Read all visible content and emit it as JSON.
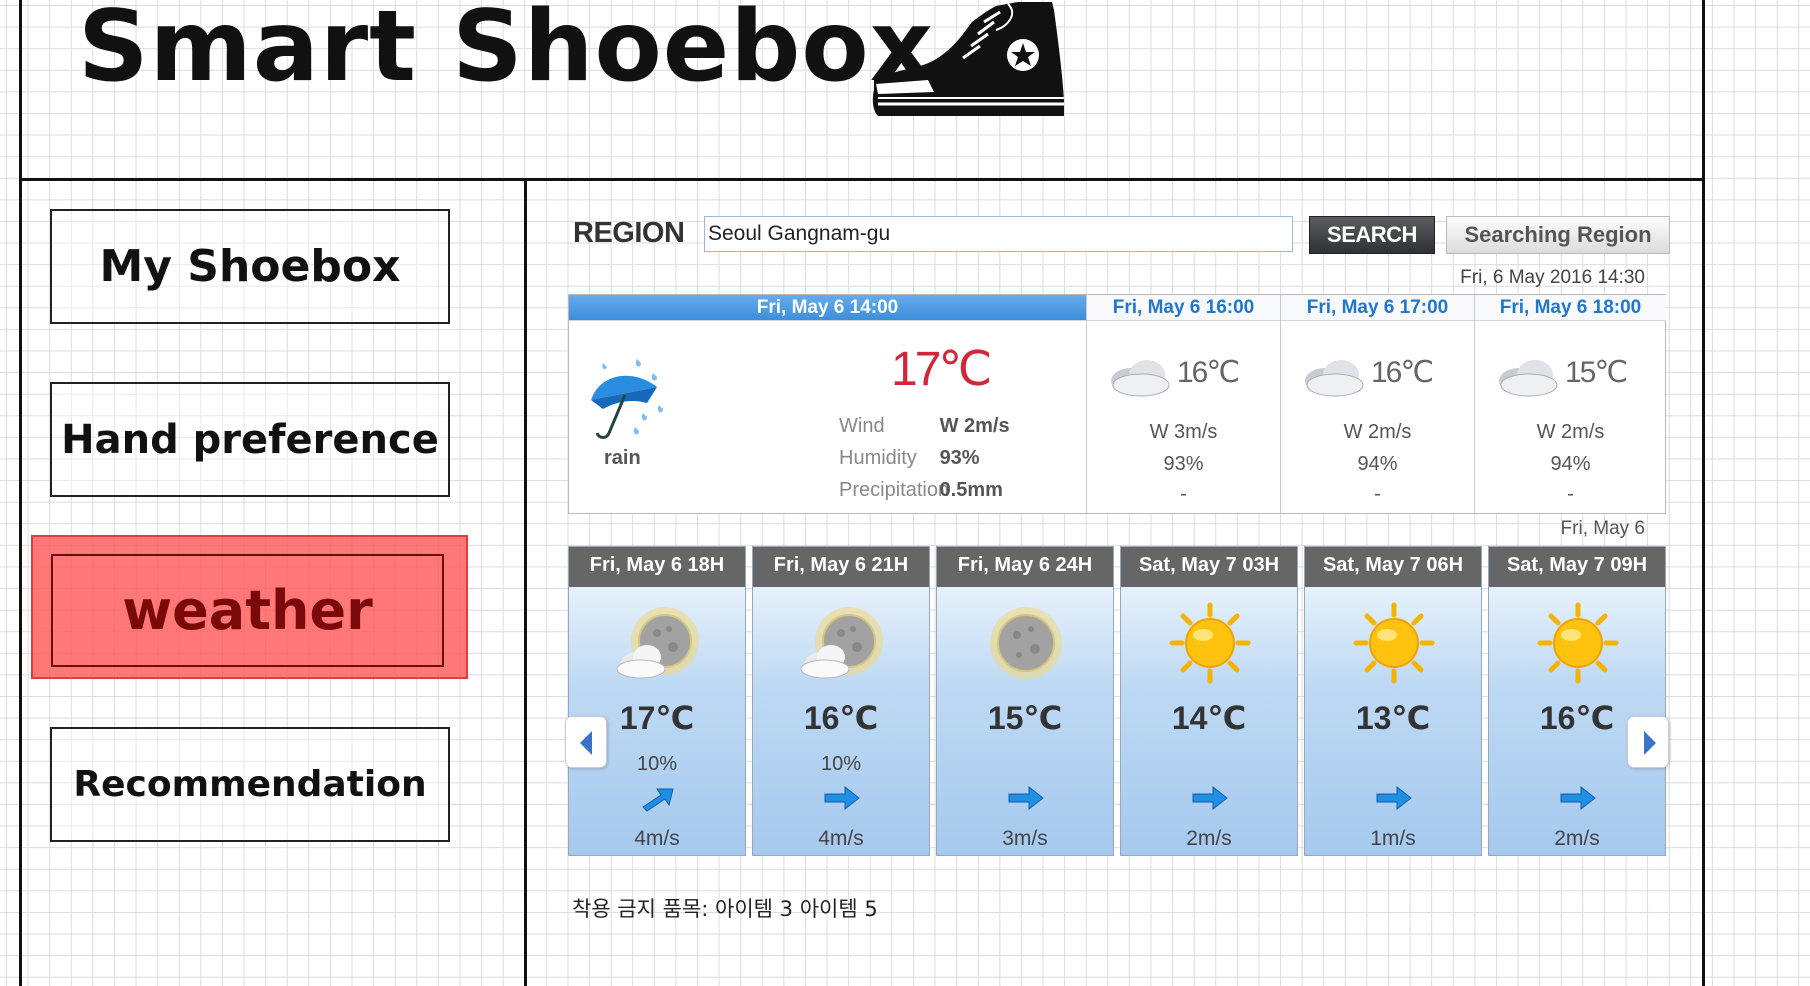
{
  "app": {
    "title": "Smart Shoebox"
  },
  "icons": {
    "logo": "sneaker-icon",
    "rain": "rain-umbrella-icon",
    "cloudy": "cloud-icon",
    "moon_cloud": "moon-cloud-icon",
    "moon": "moon-icon",
    "sun": "sun-icon",
    "wind": "wind-arrow-icon",
    "prev": "chevron-left-icon",
    "next": "chevron-right-icon"
  },
  "colors": {
    "active_nav": "#ff5a5a",
    "active_text": "#7a0909",
    "current_temp": "#d0283a",
    "header_blue": "#3d8edb",
    "card_head": "#666666"
  },
  "sidebar": {
    "items": [
      {
        "label": "My Shoebox",
        "active": false
      },
      {
        "label": "Hand preference",
        "active": false
      },
      {
        "label": "weather",
        "active": true
      },
      {
        "label": "Recommendation",
        "active": false
      }
    ]
  },
  "region": {
    "label": "REGION",
    "value": "Seoul Gangnam-gu",
    "search_label": "SEARCH",
    "searching_label": "Searching Region",
    "updated": "Fri, 6 May 2016 14:30"
  },
  "current": {
    "header": "Fri, May 6  14:00",
    "temp": "17℃",
    "condition": "rain",
    "details": [
      {
        "key": "Wind",
        "value": "W 2m/s"
      },
      {
        "key": "Humidity",
        "value": "93%"
      },
      {
        "key": "Precipitation",
        "value": "0.5mm"
      }
    ]
  },
  "hourly": [
    {
      "header": "Fri, May 6  16:00",
      "temp": "16℃",
      "wind": "W 3m/s",
      "humidity": "93%",
      "precip": "-"
    },
    {
      "header": "Fri, May 6  17:00",
      "temp": "16℃",
      "wind": "W 2m/s",
      "humidity": "94%",
      "precip": "-"
    },
    {
      "header": "Fri, May 6  18:00",
      "temp": "15℃",
      "wind": "W 2m/s",
      "humidity": "94%",
      "precip": "-"
    }
  ],
  "forecast_date": "Fri, May 6",
  "forecast": [
    {
      "header": "Fri, May 6 18H",
      "icon": "moon-cloud",
      "temp": "17℃",
      "prob": "10%",
      "wind": "4m/s"
    },
    {
      "header": "Fri, May 6 21H",
      "icon": "moon-cloud",
      "temp": "16℃",
      "prob": "10%",
      "wind": "4m/s"
    },
    {
      "header": "Fri, May 6 24H",
      "icon": "moon",
      "temp": "15℃",
      "prob": "",
      "wind": "3m/s"
    },
    {
      "header": "Sat, May 7 03H",
      "icon": "sun",
      "temp": "14℃",
      "prob": "",
      "wind": "2m/s"
    },
    {
      "header": "Sat, May 7 06H",
      "icon": "sun",
      "temp": "13℃",
      "prob": "",
      "wind": "1m/s"
    },
    {
      "header": "Sat, May 7 09H",
      "icon": "sun",
      "temp": "16℃",
      "prob": "",
      "wind": "2m/s"
    }
  ],
  "footer": {
    "note": "착용 금지 품목: 아이템 3 아이템 5"
  }
}
